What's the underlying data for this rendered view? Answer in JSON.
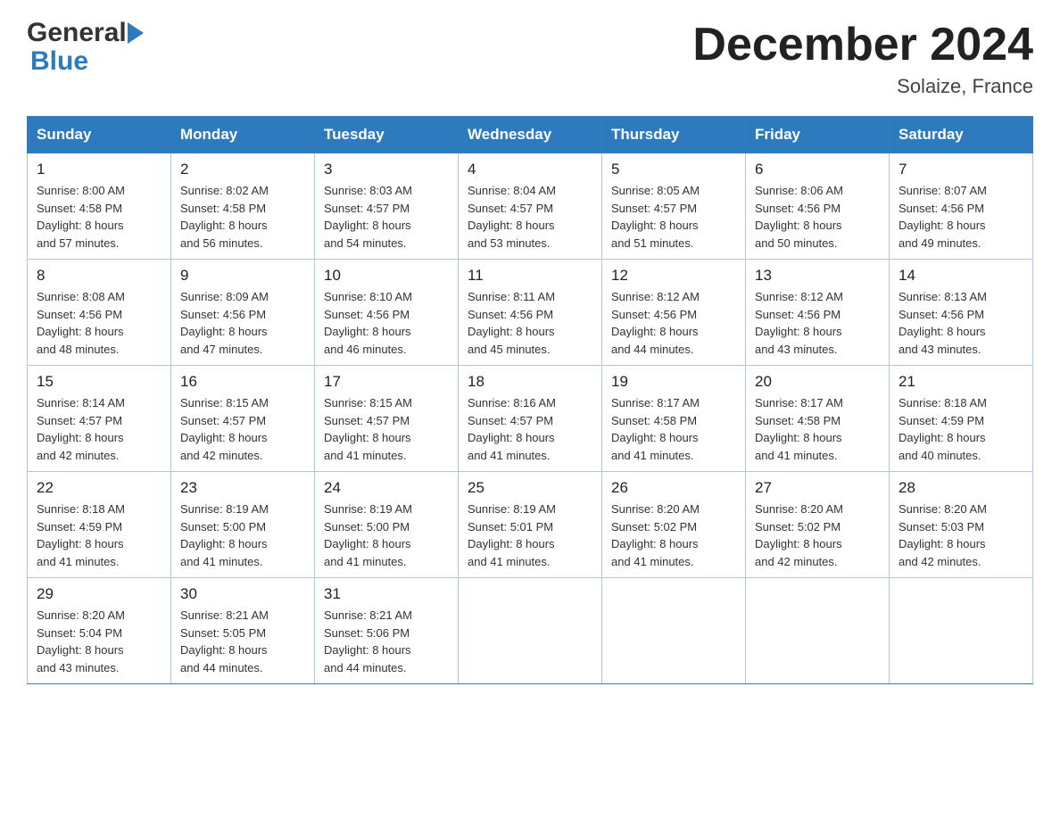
{
  "header": {
    "logo_general": "General",
    "logo_blue": "Blue",
    "title": "December 2024",
    "subtitle": "Solaize, France"
  },
  "days_of_week": [
    "Sunday",
    "Monday",
    "Tuesday",
    "Wednesday",
    "Thursday",
    "Friday",
    "Saturday"
  ],
  "weeks": [
    [
      {
        "day": "1",
        "sunrise": "8:00 AM",
        "sunset": "4:58 PM",
        "daylight": "8 hours and 57 minutes."
      },
      {
        "day": "2",
        "sunrise": "8:02 AM",
        "sunset": "4:58 PM",
        "daylight": "8 hours and 56 minutes."
      },
      {
        "day": "3",
        "sunrise": "8:03 AM",
        "sunset": "4:57 PM",
        "daylight": "8 hours and 54 minutes."
      },
      {
        "day": "4",
        "sunrise": "8:04 AM",
        "sunset": "4:57 PM",
        "daylight": "8 hours and 53 minutes."
      },
      {
        "day": "5",
        "sunrise": "8:05 AM",
        "sunset": "4:57 PM",
        "daylight": "8 hours and 51 minutes."
      },
      {
        "day": "6",
        "sunrise": "8:06 AM",
        "sunset": "4:56 PM",
        "daylight": "8 hours and 50 minutes."
      },
      {
        "day": "7",
        "sunrise": "8:07 AM",
        "sunset": "4:56 PM",
        "daylight": "8 hours and 49 minutes."
      }
    ],
    [
      {
        "day": "8",
        "sunrise": "8:08 AM",
        "sunset": "4:56 PM",
        "daylight": "8 hours and 48 minutes."
      },
      {
        "day": "9",
        "sunrise": "8:09 AM",
        "sunset": "4:56 PM",
        "daylight": "8 hours and 47 minutes."
      },
      {
        "day": "10",
        "sunrise": "8:10 AM",
        "sunset": "4:56 PM",
        "daylight": "8 hours and 46 minutes."
      },
      {
        "day": "11",
        "sunrise": "8:11 AM",
        "sunset": "4:56 PM",
        "daylight": "8 hours and 45 minutes."
      },
      {
        "day": "12",
        "sunrise": "8:12 AM",
        "sunset": "4:56 PM",
        "daylight": "8 hours and 44 minutes."
      },
      {
        "day": "13",
        "sunrise": "8:12 AM",
        "sunset": "4:56 PM",
        "daylight": "8 hours and 43 minutes."
      },
      {
        "day": "14",
        "sunrise": "8:13 AM",
        "sunset": "4:56 PM",
        "daylight": "8 hours and 43 minutes."
      }
    ],
    [
      {
        "day": "15",
        "sunrise": "8:14 AM",
        "sunset": "4:57 PM",
        "daylight": "8 hours and 42 minutes."
      },
      {
        "day": "16",
        "sunrise": "8:15 AM",
        "sunset": "4:57 PM",
        "daylight": "8 hours and 42 minutes."
      },
      {
        "day": "17",
        "sunrise": "8:15 AM",
        "sunset": "4:57 PM",
        "daylight": "8 hours and 41 minutes."
      },
      {
        "day": "18",
        "sunrise": "8:16 AM",
        "sunset": "4:57 PM",
        "daylight": "8 hours and 41 minutes."
      },
      {
        "day": "19",
        "sunrise": "8:17 AM",
        "sunset": "4:58 PM",
        "daylight": "8 hours and 41 minutes."
      },
      {
        "day": "20",
        "sunrise": "8:17 AM",
        "sunset": "4:58 PM",
        "daylight": "8 hours and 41 minutes."
      },
      {
        "day": "21",
        "sunrise": "8:18 AM",
        "sunset": "4:59 PM",
        "daylight": "8 hours and 40 minutes."
      }
    ],
    [
      {
        "day": "22",
        "sunrise": "8:18 AM",
        "sunset": "4:59 PM",
        "daylight": "8 hours and 41 minutes."
      },
      {
        "day": "23",
        "sunrise": "8:19 AM",
        "sunset": "5:00 PM",
        "daylight": "8 hours and 41 minutes."
      },
      {
        "day": "24",
        "sunrise": "8:19 AM",
        "sunset": "5:00 PM",
        "daylight": "8 hours and 41 minutes."
      },
      {
        "day": "25",
        "sunrise": "8:19 AM",
        "sunset": "5:01 PM",
        "daylight": "8 hours and 41 minutes."
      },
      {
        "day": "26",
        "sunrise": "8:20 AM",
        "sunset": "5:02 PM",
        "daylight": "8 hours and 41 minutes."
      },
      {
        "day": "27",
        "sunrise": "8:20 AM",
        "sunset": "5:02 PM",
        "daylight": "8 hours and 42 minutes."
      },
      {
        "day": "28",
        "sunrise": "8:20 AM",
        "sunset": "5:03 PM",
        "daylight": "8 hours and 42 minutes."
      }
    ],
    [
      {
        "day": "29",
        "sunrise": "8:20 AM",
        "sunset": "5:04 PM",
        "daylight": "8 hours and 43 minutes."
      },
      {
        "day": "30",
        "sunrise": "8:21 AM",
        "sunset": "5:05 PM",
        "daylight": "8 hours and 44 minutes."
      },
      {
        "day": "31",
        "sunrise": "8:21 AM",
        "sunset": "5:06 PM",
        "daylight": "8 hours and 44 minutes."
      },
      null,
      null,
      null,
      null
    ]
  ],
  "labels": {
    "sunrise": "Sunrise:",
    "sunset": "Sunset:",
    "daylight": "Daylight:"
  }
}
